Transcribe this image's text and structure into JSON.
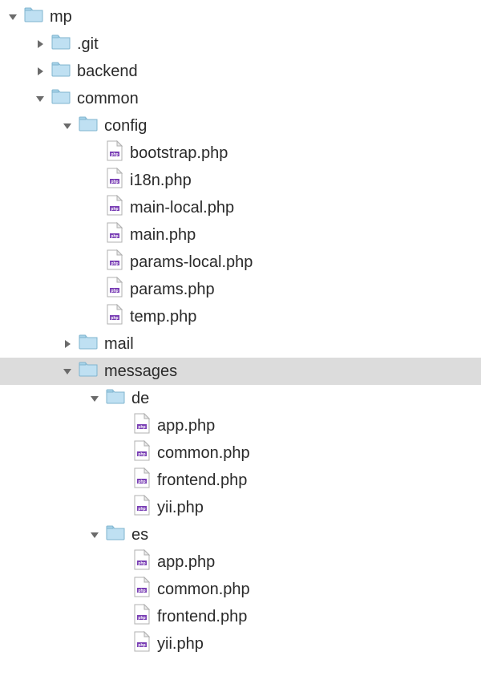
{
  "indentUnit": 34,
  "tree": [
    {
      "id": "mp",
      "label": "mp",
      "type": "folder",
      "depth": 0,
      "expanded": true,
      "selected": false
    },
    {
      "id": "git",
      "label": ".git",
      "type": "folder",
      "depth": 1,
      "expanded": false,
      "selected": false
    },
    {
      "id": "backend",
      "label": "backend",
      "type": "folder",
      "depth": 1,
      "expanded": false,
      "selected": false
    },
    {
      "id": "common",
      "label": "common",
      "type": "folder",
      "depth": 1,
      "expanded": true,
      "selected": false
    },
    {
      "id": "config",
      "label": "config",
      "type": "folder",
      "depth": 2,
      "expanded": true,
      "selected": false
    },
    {
      "id": "bootstrap-php",
      "label": "bootstrap.php",
      "type": "file",
      "depth": 3,
      "selected": false
    },
    {
      "id": "i18n-php",
      "label": "i18n.php",
      "type": "file",
      "depth": 3,
      "selected": false
    },
    {
      "id": "main-local-php",
      "label": "main-local.php",
      "type": "file",
      "depth": 3,
      "selected": false
    },
    {
      "id": "main-php",
      "label": "main.php",
      "type": "file",
      "depth": 3,
      "selected": false
    },
    {
      "id": "params-local-php",
      "label": "params-local.php",
      "type": "file",
      "depth": 3,
      "selected": false
    },
    {
      "id": "params-php",
      "label": "params.php",
      "type": "file",
      "depth": 3,
      "selected": false
    },
    {
      "id": "temp-php",
      "label": "temp.php",
      "type": "file",
      "depth": 3,
      "selected": false
    },
    {
      "id": "mail",
      "label": "mail",
      "type": "folder",
      "depth": 2,
      "expanded": false,
      "selected": false
    },
    {
      "id": "messages",
      "label": "messages",
      "type": "folder",
      "depth": 2,
      "expanded": true,
      "selected": true
    },
    {
      "id": "de",
      "label": "de",
      "type": "folder",
      "depth": 3,
      "expanded": true,
      "selected": false
    },
    {
      "id": "de-app-php",
      "label": "app.php",
      "type": "file",
      "depth": 4,
      "selected": false
    },
    {
      "id": "de-common-php",
      "label": "common.php",
      "type": "file",
      "depth": 4,
      "selected": false
    },
    {
      "id": "de-frontend-php",
      "label": "frontend.php",
      "type": "file",
      "depth": 4,
      "selected": false
    },
    {
      "id": "de-yii-php",
      "label": "yii.php",
      "type": "file",
      "depth": 4,
      "selected": false
    },
    {
      "id": "es",
      "label": "es",
      "type": "folder",
      "depth": 3,
      "expanded": true,
      "selected": false
    },
    {
      "id": "es-app-php",
      "label": "app.php",
      "type": "file",
      "depth": 4,
      "selected": false
    },
    {
      "id": "es-common-php",
      "label": "common.php",
      "type": "file",
      "depth": 4,
      "selected": false
    },
    {
      "id": "es-frontend-php",
      "label": "frontend.php",
      "type": "file",
      "depth": 4,
      "selected": false
    },
    {
      "id": "es-yii-php",
      "label": "yii.php",
      "type": "file",
      "depth": 4,
      "selected": false
    }
  ]
}
